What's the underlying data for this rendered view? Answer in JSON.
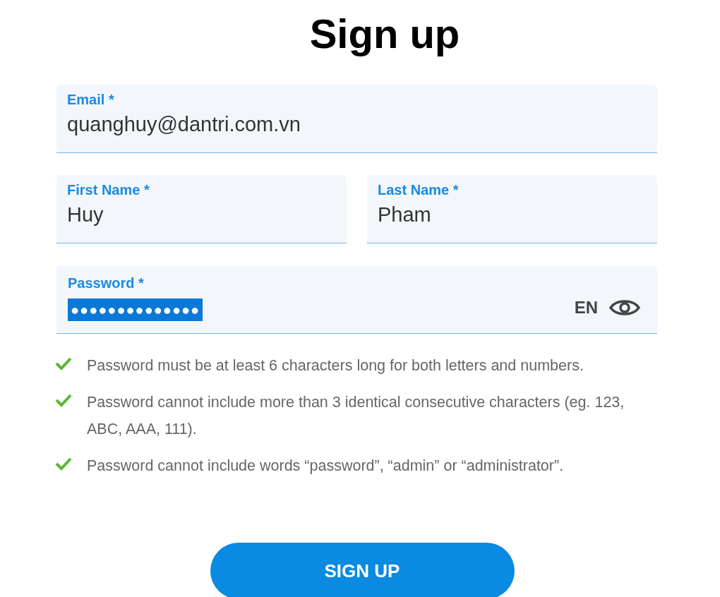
{
  "title": "Sign up",
  "fields": [
    {
      "label": "Email *",
      "value": "quanghuy@dantri.com.vn"
    }
  ],
  "name_fields": [
    {
      "label": "First Name *",
      "value": "Huy"
    },
    {
      "label": "Last Name *",
      "value": "Pham"
    }
  ],
  "password": {
    "label": "Password *",
    "value": "●●●●●●●●●●●●●●",
    "text_selected": true,
    "language": "EN"
  },
  "rules": [
    {
      "text": "Password must be at least 6 characters long for both letters and numbers.",
      "met": true
    },
    {
      "text": "Password cannot include more than 3 identical consecutive characters (eg. 123, ABC, AAA, 111).",
      "met": true
    },
    {
      "text": "Password cannot include words “password”, “admin” or “administrator”.",
      "met": true
    }
  ],
  "submit": "SIGN UP"
}
